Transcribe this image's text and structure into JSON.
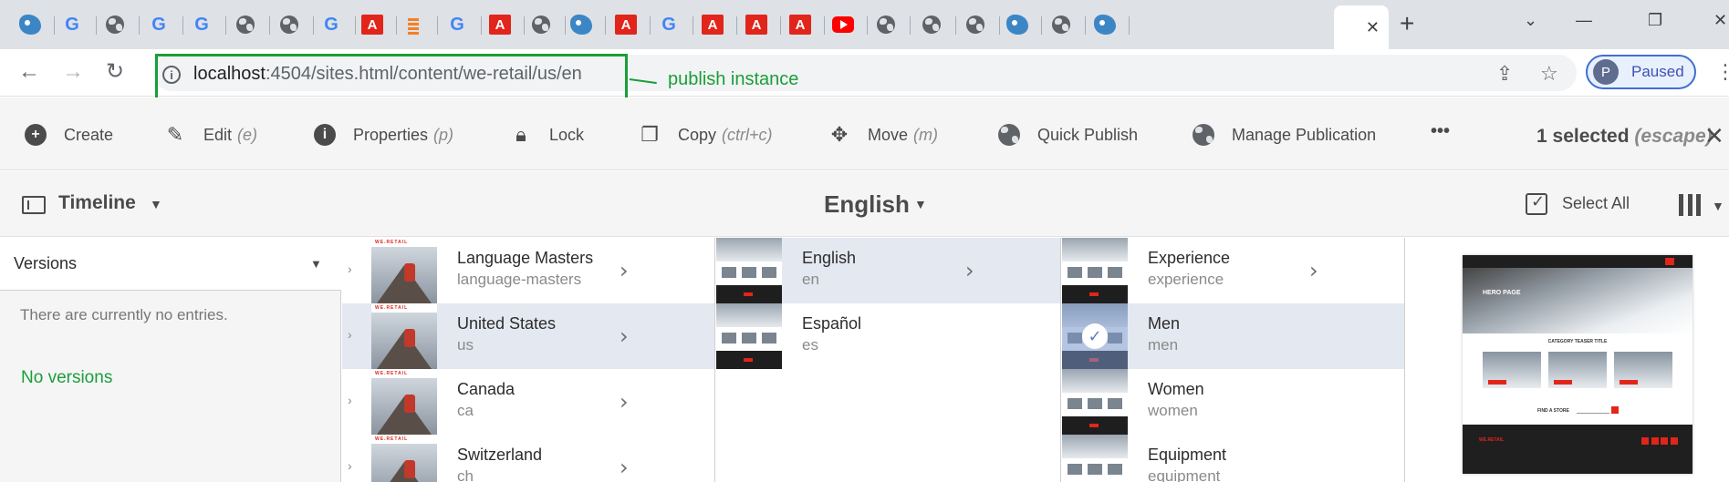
{
  "browser": {
    "tabs": [
      {
        "icon": "app-bird-icon"
      },
      {
        "icon": "google-icon",
        "glyph": "G"
      },
      {
        "icon": "globe-icon"
      },
      {
        "icon": "google-icon",
        "glyph": "G"
      },
      {
        "icon": "google-icon",
        "glyph": "G"
      },
      {
        "icon": "globe-icon"
      },
      {
        "icon": "globe-icon"
      },
      {
        "icon": "google-icon",
        "glyph": "G"
      },
      {
        "icon": "adobe-icon",
        "glyph": "A"
      },
      {
        "icon": "stackoverflow-icon"
      },
      {
        "icon": "google-icon",
        "glyph": "G"
      },
      {
        "icon": "adobe-icon",
        "glyph": "A"
      },
      {
        "icon": "globe-icon"
      },
      {
        "icon": "app-bird-icon"
      },
      {
        "icon": "adobe-icon",
        "glyph": "A"
      },
      {
        "icon": "google-icon",
        "glyph": "G"
      },
      {
        "icon": "adobe-icon",
        "glyph": "A"
      },
      {
        "icon": "adobe-icon",
        "glyph": "A"
      },
      {
        "icon": "adobe-icon",
        "glyph": "A"
      },
      {
        "icon": "youtube-icon"
      },
      {
        "icon": "globe-icon"
      },
      {
        "icon": "globe-icon"
      },
      {
        "icon": "globe-icon"
      },
      {
        "icon": "app-bird-icon"
      },
      {
        "icon": "globe-icon"
      },
      {
        "icon": "app-bird-icon"
      }
    ],
    "active_tab_close": "✕",
    "new_tab": "+",
    "window_controls": {
      "dropdown": "⌄",
      "minimize": "—",
      "restore": "❐",
      "close": "✕"
    },
    "nav": {
      "back": "←",
      "forward": "→",
      "reload": "↻"
    },
    "url_host": "localhost",
    "url_rest": ":4504/sites.html/content/we-retail/us/en",
    "annotation": "publish instance",
    "profile_initial": "P",
    "profile_label": "Paused",
    "colors": {
      "annotation": "#1a9e3a",
      "tabstrip": "#dee1e6"
    }
  },
  "actions": {
    "create": {
      "label": "Create",
      "icon": "plus-circle-icon"
    },
    "edit": {
      "label": "Edit",
      "shortcut": "(e)",
      "icon": "pencil-icon"
    },
    "properties": {
      "label": "Properties",
      "shortcut": "(p)",
      "icon": "info-icon"
    },
    "lock": {
      "label": "Lock",
      "icon": "lock-icon"
    },
    "copy": {
      "label": "Copy",
      "shortcut": "(ctrl+c)",
      "icon": "copy-icon"
    },
    "move": {
      "label": "Move",
      "shortcut": "(m)",
      "icon": "move-icon"
    },
    "quick_publish": {
      "label": "Quick Publish",
      "icon": "globe-icon"
    },
    "manage_publication": {
      "label": "Manage Publication",
      "icon": "globe-clock-icon"
    },
    "more": "•••",
    "selection_count": "1 selected",
    "selection_hint": "(escape)",
    "close": "✕"
  },
  "railbar": {
    "rail_title": "Timeline",
    "breadcrumb": "English",
    "select_all": "Select All"
  },
  "rail": {
    "versions_label": "Versions",
    "no_entries": "There are currently no entries.",
    "no_versions": "No versions"
  },
  "columns": [
    {
      "items": [
        {
          "title": "Language Masters",
          "name": "language-masters",
          "thumb": "mountain",
          "has_children": true,
          "selected": false
        },
        {
          "title": "United States",
          "name": "us",
          "thumb": "mountain",
          "has_children": true,
          "selected": true
        },
        {
          "title": "Canada",
          "name": "ca",
          "thumb": "mountain",
          "has_children": true,
          "selected": false
        },
        {
          "title": "Switzerland",
          "name": "ch",
          "thumb": "mountain",
          "has_children": true,
          "selected": false
        }
      ]
    },
    {
      "items": [
        {
          "title": "English",
          "name": "en",
          "thumb": "web",
          "has_children": true,
          "selected": true
        },
        {
          "title": "Español",
          "name": "es",
          "thumb": "web",
          "has_children": false,
          "selected": false
        }
      ]
    },
    {
      "items": [
        {
          "title": "Experience",
          "name": "experience",
          "thumb": "web",
          "has_children": true,
          "selected": false
        },
        {
          "title": "Men",
          "name": "men",
          "thumb": "web",
          "has_children": false,
          "selected": true,
          "checked": true
        },
        {
          "title": "Women",
          "name": "women",
          "thumb": "web",
          "has_children": false,
          "selected": false
        },
        {
          "title": "Equipment",
          "name": "equipment",
          "thumb": "web",
          "has_children": false,
          "selected": false
        }
      ]
    }
  ],
  "preview": {
    "hero_text": "HERO PAGE",
    "category_title": "CATEGORY TEASER TITLE",
    "find_store": "FIND A STORE",
    "footer_brand": "WE.RETAIL"
  }
}
